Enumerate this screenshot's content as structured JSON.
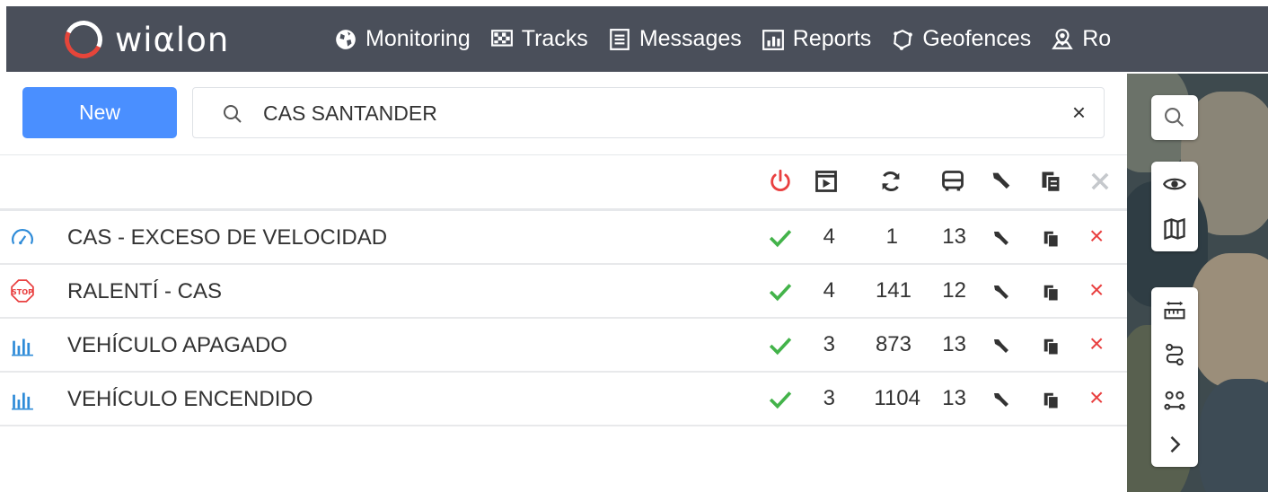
{
  "app": {
    "logo_text": "wiαlon",
    "brand_color": "#4a4f5a",
    "accent": "#4a8fff"
  },
  "nav": [
    {
      "label": "Monitoring",
      "icon": "globe-icon"
    },
    {
      "label": "Tracks",
      "icon": "checkered-flag-icon"
    },
    {
      "label": "Messages",
      "icon": "messages-icon"
    },
    {
      "label": "Reports",
      "icon": "reports-icon"
    },
    {
      "label": "Geofences",
      "icon": "geofence-icon"
    },
    {
      "label": "Ro",
      "icon": "routes-icon"
    }
  ],
  "toolbar": {
    "new_label": "New"
  },
  "search": {
    "value": "CAS SANTANDER",
    "clear": "×"
  },
  "columns": [
    "power-icon",
    "play-icon",
    "refresh-icon",
    "bus-icon",
    "wrench-icon",
    "copy-icon",
    "close-icon"
  ],
  "rows": [
    {
      "icon": "speedometer-icon",
      "name": "CAS - EXCESO DE VELOCIDAD",
      "col1": "4",
      "col2": "1",
      "col3": "13"
    },
    {
      "icon": "stop-sign-icon",
      "name": "RALENTÍ - CAS",
      "col1": "4",
      "col2": "141",
      "col3": "12"
    },
    {
      "icon": "bar-chart-icon",
      "name": "VEHÍCULO APAGADO",
      "col1": "3",
      "col2": "873",
      "col3": "13"
    },
    {
      "icon": "bar-chart-icon",
      "name": "VEHÍCULO ENCENDIDO",
      "col1": "3",
      "col2": "1104",
      "col3": "13"
    }
  ],
  "row_delete": "×",
  "colors": {
    "check": "#43b34a",
    "delete": "#e94040",
    "power": "#e94040",
    "chart_icon": "#2e8bd8"
  },
  "map_controls": [
    "search-icon",
    "eye-icon",
    "map-icon",
    "ruler-icon",
    "route-icon",
    "waypoints-icon",
    "chevron-right-icon"
  ]
}
